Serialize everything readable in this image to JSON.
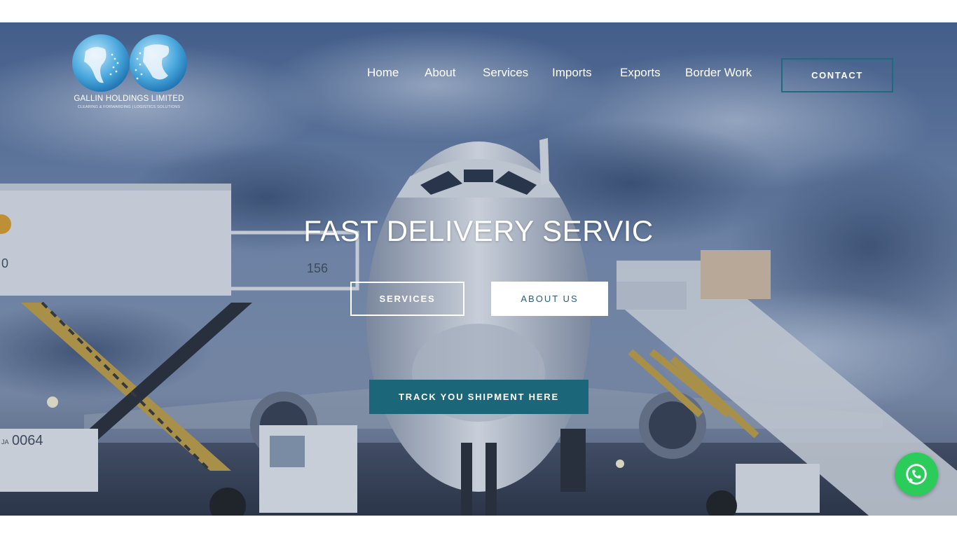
{
  "brand": {
    "name": "GALLIN HOLDINGS LIMITED",
    "tagline": "CLEARING & FORWARDING | LOGISTICS SOLUTIONS"
  },
  "nav": {
    "items": [
      {
        "label": "Home"
      },
      {
        "label": "About"
      },
      {
        "label": "Services"
      },
      {
        "label": "Imports"
      },
      {
        "label": "Exports"
      },
      {
        "label": "Border Work"
      }
    ],
    "contact_label": "CONTACT"
  },
  "hero": {
    "headline": "FAST DELIVERY SERVIC",
    "services_label": "SERVICES",
    "about_label": "ABOUT US",
    "track_label": "TRACK YOU SHIPMENT HERE",
    "photo_markings": {
      "stair_number": "156",
      "truck_number": "0064",
      "truck_prefix": "JA",
      "container_number": "0"
    }
  },
  "colors": {
    "accent": "#1b6678",
    "contact_border": "#1d6b7d",
    "whatsapp": "#2bcc5a"
  },
  "icons": {
    "whatsapp": "whatsapp-icon",
    "logo": "globe-logo-icon"
  }
}
